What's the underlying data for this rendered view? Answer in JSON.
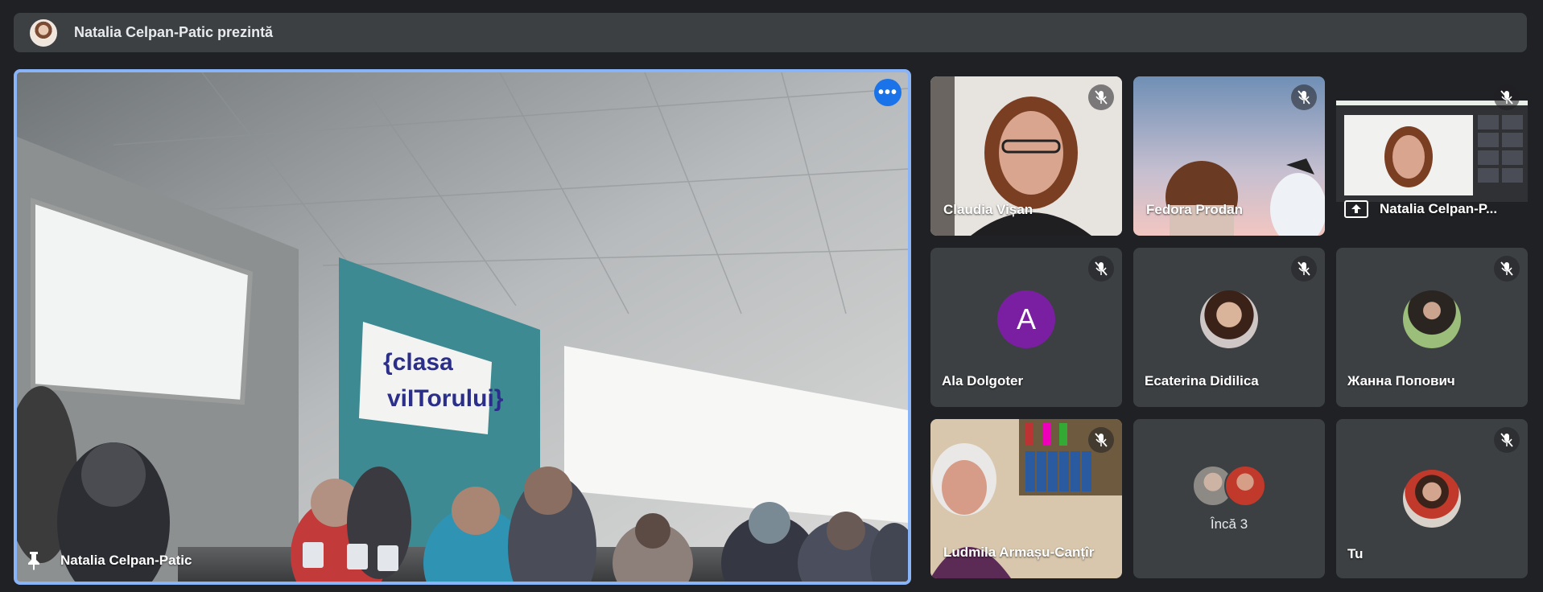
{
  "banner": {
    "presenter_text": "Natalia Celpan-Patic prezintă"
  },
  "main": {
    "participant_name": "Natalia Celpan-Patic",
    "more_options_glyph": "•••",
    "pin_icon": "pin-icon",
    "scene_sign_line1": "{clasa",
    "scene_sign_line2": "viITorului}"
  },
  "tiles": [
    {
      "name": "Claudia Vișan",
      "muted": true,
      "kind": "video"
    },
    {
      "name": "Fedora Prodan",
      "muted": true,
      "kind": "video"
    },
    {
      "name": "Natalia Celpan-P...",
      "muted": true,
      "kind": "screen-share"
    },
    {
      "name": "Ala Dolgoter",
      "muted": true,
      "kind": "letter-avatar",
      "letter": "A"
    },
    {
      "name": "Ecaterina Didilica",
      "muted": true,
      "kind": "photo-avatar"
    },
    {
      "name": "Жанна Попович",
      "muted": true,
      "kind": "photo-avatar"
    },
    {
      "name": "Ludmila Armașu-Canțîr",
      "muted": true,
      "kind": "video"
    },
    {
      "name": "",
      "muted": false,
      "kind": "overflow",
      "more_label": "Încă 3"
    },
    {
      "name": "Tu",
      "muted": true,
      "kind": "photo-avatar"
    }
  ],
  "colors": {
    "accent": "#8ab4f8",
    "button": "#1a73e8",
    "tile": "#3c4043",
    "background": "#202124",
    "letter_avatar": "#7b1fa2"
  }
}
